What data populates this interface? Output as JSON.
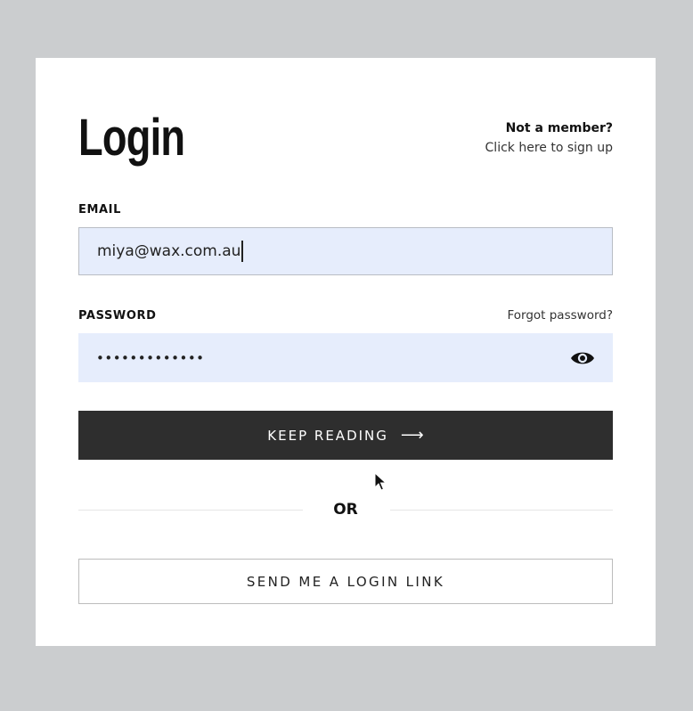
{
  "login": {
    "title": "Login",
    "not_member": "Not a member?",
    "signup_link": "Click here to sign up",
    "email_label": "EMAIL",
    "email_value": "miya@wax.com.au",
    "password_label": "PASSWORD",
    "forgot_password": "Forgot password?",
    "password_value": "•••••••••••••",
    "primary_button": "KEEP READING",
    "primary_button_arrow": "⟶",
    "or_text": "OR",
    "secondary_button": "SEND ME A LOGIN LINK"
  },
  "icons": {
    "password_toggle": "eye-icon",
    "button_arrow": "arrow-right-icon",
    "pointer": "mouse-cursor-icon"
  },
  "colors": {
    "background": "#cbcdcf",
    "card": "#ffffff",
    "input_fill": "#e6edfc",
    "primary_button": "#2e2e2e",
    "primary_button_text": "#ffffff"
  }
}
